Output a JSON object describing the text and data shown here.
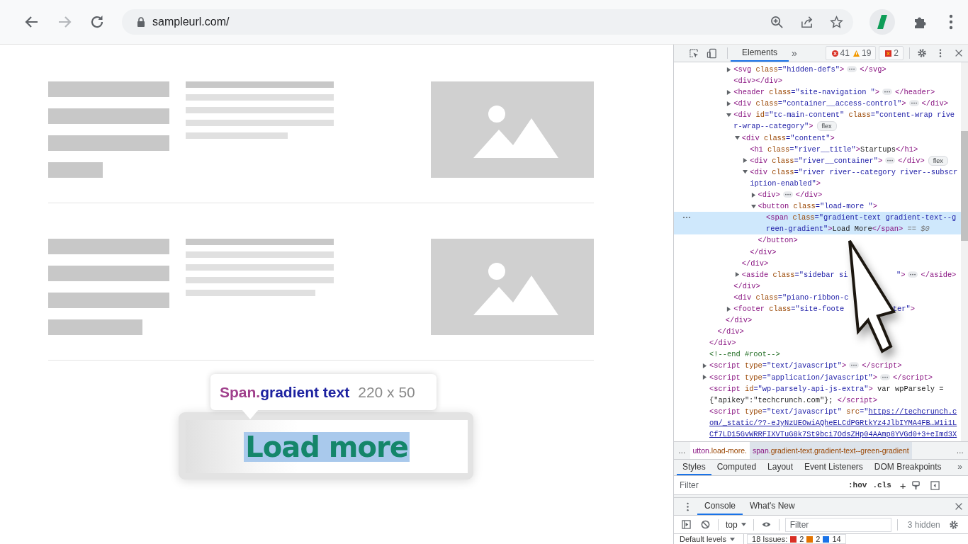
{
  "browser": {
    "forward_disabled": true,
    "url": "sampleurl.com/"
  },
  "page": {
    "tooltip": {
      "element": "Span.",
      "selector": "gradient text",
      "size": "220 x 50"
    },
    "load_button": {
      "label": "Load more",
      "highlighted": true
    }
  },
  "devtools": {
    "tabs": [
      {
        "label": "Elements",
        "selected": true
      }
    ],
    "tabs_overflow": "»",
    "errors": "41",
    "warnings": "19",
    "issues": "2",
    "tree": [
      {
        "children": [
          {
            "children": [
              {
                "children": [
                  {
                    "expanded": false,
                    "selected": false,
                    "open": [
                      [
                        {
                          "kind": "tag",
                          "text": "<svg"
                        },
                        {
                          "kind": "attr",
                          "text": " class"
                        },
                        {
                          "kind": "val",
                          "text": "=\"hidden-defs\""
                        },
                        {
                          "kind": "tag",
                          "text": ">"
                        },
                        {
                          "kind": "more"
                        },
                        {
                          "kind": "tag",
                          "text": "</svg>"
                        }
                      ]
                    ]
                  },
                  {
                    "selected": false,
                    "open": [
                      [
                        {
                          "kind": "tag",
                          "text": "<div></div>"
                        }
                      ]
                    ]
                  },
                  {
                    "expanded": false,
                    "selected": false,
                    "open": [
                      [
                        {
                          "kind": "tag",
                          "text": "<header"
                        },
                        {
                          "kind": "attr",
                          "text": " class"
                        },
                        {
                          "kind": "val",
                          "text": "=\"site-navigation \""
                        },
                        {
                          "kind": "tag",
                          "text": ">"
                        },
                        {
                          "kind": "more"
                        },
                        {
                          "kind": "tag",
                          "text": "</header>"
                        }
                      ]
                    ]
                  },
                  {
                    "expanded": false,
                    "selected": false,
                    "open": [
                      [
                        {
                          "kind": "tag",
                          "text": "<div"
                        },
                        {
                          "kind": "attr",
                          "text": " class"
                        },
                        {
                          "kind": "val",
                          "text": "=\"container__access-control\""
                        },
                        {
                          "kind": "tag",
                          "text": ">"
                        },
                        {
                          "kind": "more"
                        },
                        {
                          "kind": "tag",
                          "text": "</div>"
                        }
                      ]
                    ]
                  },
                  {
                    "expanded": true,
                    "selected": false,
                    "open": [
                      [
                        {
                          "kind": "tag",
                          "text": "<div"
                        },
                        {
                          "kind": "attr",
                          "text": " id"
                        },
                        {
                          "kind": "val",
                          "text": "=\"tc-main-content\""
                        },
                        {
                          "kind": "attr",
                          "text": " class"
                        },
                        {
                          "kind": "val",
                          "text": "=\"content-wrap rive"
                        }
                      ],
                      [
                        {
                          "kind": "val",
                          "text": "r-wrap--category\""
                        },
                        {
                          "kind": "tag",
                          "text": ">"
                        },
                        {
                          "kind": "badge",
                          "text": "flex"
                        }
                      ]
                    ],
                    "close": [
                      {
                        "kind": "tag",
                        "text": "</div>"
                      }
                    ],
                    "children": [
                      {
                        "expanded": true,
                        "selected": false,
                        "open": [
                          [
                            {
                              "kind": "tag",
                              "text": "<div"
                            },
                            {
                              "kind": "attr",
                              "text": " class"
                            },
                            {
                              "kind": "val",
                              "text": "=\"content\""
                            },
                            {
                              "kind": "tag",
                              "text": ">"
                            }
                          ]
                        ],
                        "close": [
                          {
                            "kind": "tag",
                            "text": "</div>"
                          }
                        ],
                        "children": [
                          {
                            "selected": false,
                            "open": [
                              [
                                {
                                  "kind": "tag",
                                  "text": "<h1"
                                },
                                {
                                  "kind": "attr",
                                  "text": " class"
                                },
                                {
                                  "kind": "val",
                                  "text": "=\"river__title\""
                                },
                                {
                                  "kind": "tag",
                                  "text": ">"
                                },
                                {
                                  "kind": "text",
                                  "text": "Startups"
                                },
                                {
                                  "kind": "tag",
                                  "text": "</h1>"
                                }
                              ]
                            ]
                          },
                          {
                            "expanded": false,
                            "selected": false,
                            "open": [
                              [
                                {
                                  "kind": "tag",
                                  "text": "<div"
                                },
                                {
                                  "kind": "attr",
                                  "text": " class"
                                },
                                {
                                  "kind": "val",
                                  "text": "=\"river__container\""
                                },
                                {
                                  "kind": "tag",
                                  "text": ">"
                                },
                                {
                                  "kind": "more"
                                },
                                {
                                  "kind": "tag",
                                  "text": "</div>"
                                },
                                {
                                  "kind": "badge",
                                  "text": "flex"
                                }
                              ]
                            ]
                          },
                          {
                            "expanded": true,
                            "selected": false,
                            "open": [
                              [
                                {
                                  "kind": "tag",
                                  "text": "<div"
                                },
                                {
                                  "kind": "attr",
                                  "text": " class"
                                },
                                {
                                  "kind": "val",
                                  "text": "=\"river river--category river--subscr"
                                }
                              ],
                              [
                                {
                                  "kind": "val",
                                  "text": "iption-enabled\""
                                },
                                {
                                  "kind": "tag",
                                  "text": ">"
                                }
                              ]
                            ],
                            "close": [
                              {
                                "kind": "tag",
                                "text": "</div>"
                              }
                            ],
                            "children": [
                              {
                                "expanded": false,
                                "selected": false,
                                "open": [
                                  [
                                    {
                                      "kind": "tag",
                                      "text": "<div>"
                                    },
                                    {
                                      "kind": "more"
                                    },
                                    {
                                      "kind": "tag",
                                      "text": "</div>"
                                    }
                                  ]
                                ]
                              },
                              {
                                "expanded": true,
                                "selected": false,
                                "open": [
                                  [
                                    {
                                      "kind": "tag",
                                      "text": "<button"
                                    },
                                    {
                                      "kind": "attr",
                                      "text": " class"
                                    },
                                    {
                                      "kind": "val",
                                      "text": "=\"load-more \""
                                    },
                                    {
                                      "kind": "tag",
                                      "text": ">"
                                    }
                                  ]
                                ],
                                "close": [
                                  {
                                    "kind": "tag",
                                    "text": "</button>"
                                  }
                                ],
                                "children": [
                                  {
                                    "selected": true,
                                    "open": [
                                      [
                                        {
                                          "kind": "tag",
                                          "text": "<span"
                                        },
                                        {
                                          "kind": "attr",
                                          "text": " class"
                                        },
                                        {
                                          "kind": "val",
                                          "text": "=\"gradient-text gradient-text--g"
                                        }
                                      ],
                                      [
                                        {
                                          "kind": "val",
                                          "text": "reen-gradient\""
                                        },
                                        {
                                          "kind": "tag",
                                          "text": ">"
                                        },
                                        {
                                          "kind": "text",
                                          "text": "Load More"
                                        },
                                        {
                                          "kind": "tag",
                                          "text": "</span>"
                                        },
                                        {
                                          "kind": "ref",
                                          "text": " == $0"
                                        }
                                      ]
                                    ]
                                  }
                                ]
                              }
                            ]
                          }
                        ]
                      },
                      {
                        "expanded": false,
                        "selected": false,
                        "open": [
                          [
                            {
                              "kind": "tag",
                              "text": "<aside"
                            },
                            {
                              "kind": "attr",
                              "text": " class"
                            },
                            {
                              "kind": "val",
                              "text": "=\"sidebar si"
                            },
                            {
                              "kind": "covered"
                            },
                            {
                              "kind": "val",
                              "text": "\""
                            },
                            {
                              "kind": "tag",
                              "text": ">"
                            },
                            {
                              "kind": "more"
                            },
                            {
                              "kind": "tag",
                              "text": "</aside>"
                            }
                          ]
                        ]
                      }
                    ]
                  },
                  {
                    "selected": false,
                    "open": [
                      [
                        {
                          "kind": "tag",
                          "text": "<div"
                        },
                        {
                          "kind": "attr",
                          "text": " class"
                        },
                        {
                          "kind": "val",
                          "text": "=\"piano-ribbon-c"
                        },
                        {
                          "kind": "covered"
                        }
                      ]
                    ]
                  },
                  {
                    "expanded": false,
                    "selected": false,
                    "open": [
                      [
                        {
                          "kind": "tag",
                          "text": "<footer"
                        },
                        {
                          "kind": "attr",
                          "text": " class"
                        },
                        {
                          "kind": "val",
                          "text": "=\"site-foote"
                        },
                        {
                          "kind": "covered"
                        },
                        {
                          "kind": "val",
                          "text": "ter\""
                        },
                        {
                          "kind": "tag",
                          "text": ">"
                        }
                      ]
                    ]
                  }
                ],
                "close": [
                  {
                    "kind": "tag",
                    "text": "</div>"
                  }
                ]
              }
            ],
            "close": [
              {
                "kind": "tag",
                "text": "</div>"
              }
            ]
          }
        ],
        "close": [
          {
            "kind": "tag",
            "text": "</div>"
          }
        ]
      },
      {
        "selected": false,
        "open": [
          [
            {
              "kind": "comment",
              "text": "<!--end #root-->"
            }
          ]
        ]
      },
      {
        "expanded": false,
        "selected": false,
        "open": [
          [
            {
              "kind": "tag",
              "text": "<script"
            },
            {
              "kind": "attr",
              "text": " type"
            },
            {
              "kind": "val",
              "text": "=\"text/javascript\""
            },
            {
              "kind": "tag",
              "text": ">"
            },
            {
              "kind": "more"
            },
            {
              "kind": "tag",
              "text": "</script>"
            }
          ]
        ]
      },
      {
        "expanded": false,
        "selected": false,
        "open": [
          [
            {
              "kind": "tag",
              "text": "<script"
            },
            {
              "kind": "attr",
              "text": " type"
            },
            {
              "kind": "val",
              "text": "=\"application/javascript\""
            },
            {
              "kind": "tag",
              "text": ">"
            },
            {
              "kind": "more"
            },
            {
              "kind": "tag",
              "text": "</script>"
            }
          ]
        ]
      },
      {
        "selected": false,
        "open": [
          [
            {
              "kind": "tag",
              "text": "<script"
            },
            {
              "kind": "attr",
              "text": " id"
            },
            {
              "kind": "val",
              "text": "=\"wp-parsely-api-js-extra\""
            },
            {
              "kind": "tag",
              "text": ">"
            },
            {
              "kind": "text",
              "text": " var wpParsely ="
            }
          ],
          [
            {
              "kind": "text",
              "text": "{\"apikey\":\"techcrunch.com\"}; "
            },
            {
              "kind": "tag",
              "text": "</script>"
            }
          ]
        ]
      },
      {
        "selected": false,
        "open": [
          [
            {
              "kind": "tag",
              "text": "<script"
            },
            {
              "kind": "attr",
              "text": " type"
            },
            {
              "kind": "val",
              "text": "=\"text/javascript\""
            },
            {
              "kind": "attr",
              "text": " src"
            },
            {
              "kind": "val",
              "text": "=\""
            },
            {
              "kind": "link",
              "text": "https://techcrunch.c"
            }
          ],
          [
            {
              "kind": "link",
              "text": "om/_static/??-eJyNzUEOwiAQheELCdPGRtkYz4JlbIYMA4FB…W1i1L"
            }
          ],
          [
            {
              "kind": "link",
              "text": "Cf7LD15GvWRRFIXVTuG8k7St9bci7OdsZHp04AAmp8YVGd0+3+eImd3X"
            }
          ]
        ]
      }
    ],
    "breadcrumbs": {
      "before": "…",
      "items": [
        {
          "tag": "utton",
          "cls": ".load-more.",
          "selected": false
        },
        {
          "tag": "span",
          "cls": ".gradient-text.gradient-text--green-gradient",
          "selected": true
        }
      ],
      "after": "…"
    },
    "styles_tabs": [
      {
        "label": "Styles",
        "selected": true
      },
      {
        "label": "Computed",
        "selected": false
      },
      {
        "label": "Layout",
        "selected": false
      },
      {
        "label": "Event Listeners",
        "selected": false
      },
      {
        "label": "DOM Breakpoints",
        "selected": false
      }
    ],
    "styles_overflow": "»",
    "styles_filter": {
      "placeholder": "Filter"
    },
    "hov": ":hov",
    "cls": ".cls",
    "plus": "+",
    "drawer_tabs": [
      {
        "label": "Console",
        "selected": true
      },
      {
        "label": "What's New",
        "selected": false
      }
    ],
    "console": {
      "context": "top",
      "filter_placeholder": "Filter",
      "hidden": "3 hidden",
      "levels": "Default levels",
      "issues_label": "18 Issues:",
      "issue_counts": [
        {
          "count": "2",
          "color": "#d93025"
        },
        {
          "count": "2",
          "color": "#e37400"
        },
        {
          "count": "14",
          "color": "#1a73e8"
        }
      ]
    }
  }
}
